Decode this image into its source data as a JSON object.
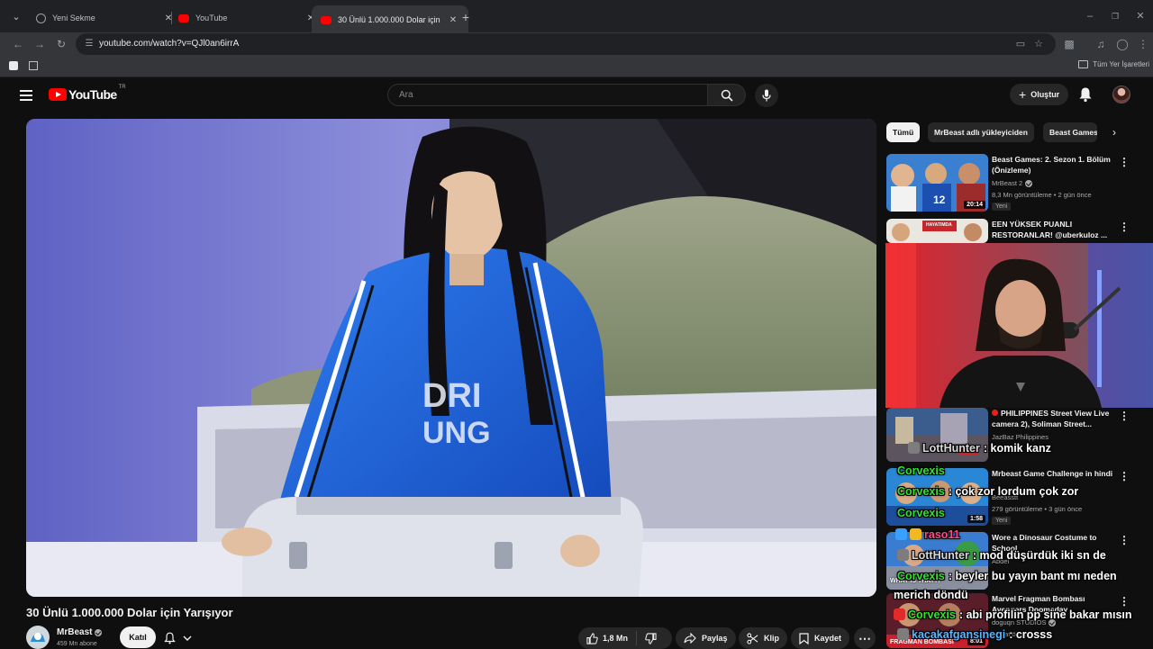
{
  "browser": {
    "tabs": [
      {
        "title": "Yeni Sekme",
        "active": false
      },
      {
        "title": "YouTube",
        "active": false
      },
      {
        "title": "30 Ünlü 1.000.000 Dolar için Yarışıyor",
        "active": true
      }
    ],
    "url": "youtube.com/watch?v=QJl0an6irrA",
    "bookmarks_all": "Tüm Yer İşaretleri"
  },
  "youtube": {
    "logo_text": "YouTube",
    "country_code": "TR",
    "search_placeholder": "Ara",
    "create_label": "Oluştur"
  },
  "video": {
    "title": "30 Ünlü 1.000.000 Dolar için Yarışıyor",
    "channel": "MrBeast",
    "subscribers": "459 Mn abone",
    "join_label": "Katıl",
    "likes": "1,8 Mn",
    "share_label": "Paylaş",
    "clip_label": "Klip",
    "save_label": "Kaydet"
  },
  "sidebar": {
    "chips": [
      "Tümü",
      "MrBeast adlı yükleyiciden",
      "Beast Games"
    ],
    "recommendations": [
      {
        "title": "Beast Games: 2. Sezon 1. Bölüm (Önizleme)",
        "channel": "MrBeast 2",
        "meta": "8,3 Mn görüntüleme • 2 gün önce",
        "badge": "Yeni",
        "duration": "20:14"
      },
      {
        "title": "EEN YÜKSEK PUANLI RESTORANLAR! @uberkuloz ...",
        "channel": "",
        "meta": "",
        "badge": "",
        "duration": "",
        "thumb_text": "HAYATIMDA"
      },
      {
        "title": "PHILIPPINES Street View Live camera 2), Soliman Street...",
        "channel": "JazBaz Philippines",
        "meta": "",
        "badge": "",
        "duration": "",
        "live": true
      },
      {
        "title": "Mrbeast Game Challenge in hindi",
        "channel": "Beeasstt",
        "meta": "279 görüntüleme • 3 gün önce",
        "badge": "Yeni",
        "duration": "1:58"
      },
      {
        "title": "Wore a Dinosaur Costume to School",
        "channel": "Abdel",
        "meta": "",
        "badge": "",
        "duration": "",
        "thumb_text": "WHAT IS THAT?!"
      },
      {
        "title": "Marvel Fragman Bombası Avengers Doomsday",
        "channel": "doguqn STUDIOS",
        "meta": "1 saat önce",
        "badge": "",
        "duration": "8:01",
        "thumb_text": "FRAGMAN BOMBASI"
      }
    ]
  },
  "chat": [
    {
      "user": "LottHunter",
      "text": ": komik kanz"
    },
    {
      "user": "Corvexis",
      "text": ""
    },
    {
      "user": "Corvexis",
      "text": ": çok zor lordum çok zor"
    },
    {
      "user": "Corvexis",
      "text": ""
    },
    {
      "user": "raso11",
      "text": ""
    },
    {
      "user": "LottHunter",
      "text": ": mod düşürdük iki sn de"
    },
    {
      "user": "Corvexis",
      "text": ": beyler bu yayın bant mı neden"
    },
    {
      "user": "",
      "text": "merich döndü"
    },
    {
      "user": "Corvexis",
      "text": ": abi profilin pp sine bakar mısın"
    },
    {
      "user": "kacakafgansinegi",
      "text": ": crosss"
    }
  ],
  "colors": {
    "yt_red": "#ff0000",
    "page_bg": "#0f0f0f",
    "chat_user_green": "#2fe42f",
    "chat_user_blue": "#5bb8ff"
  }
}
